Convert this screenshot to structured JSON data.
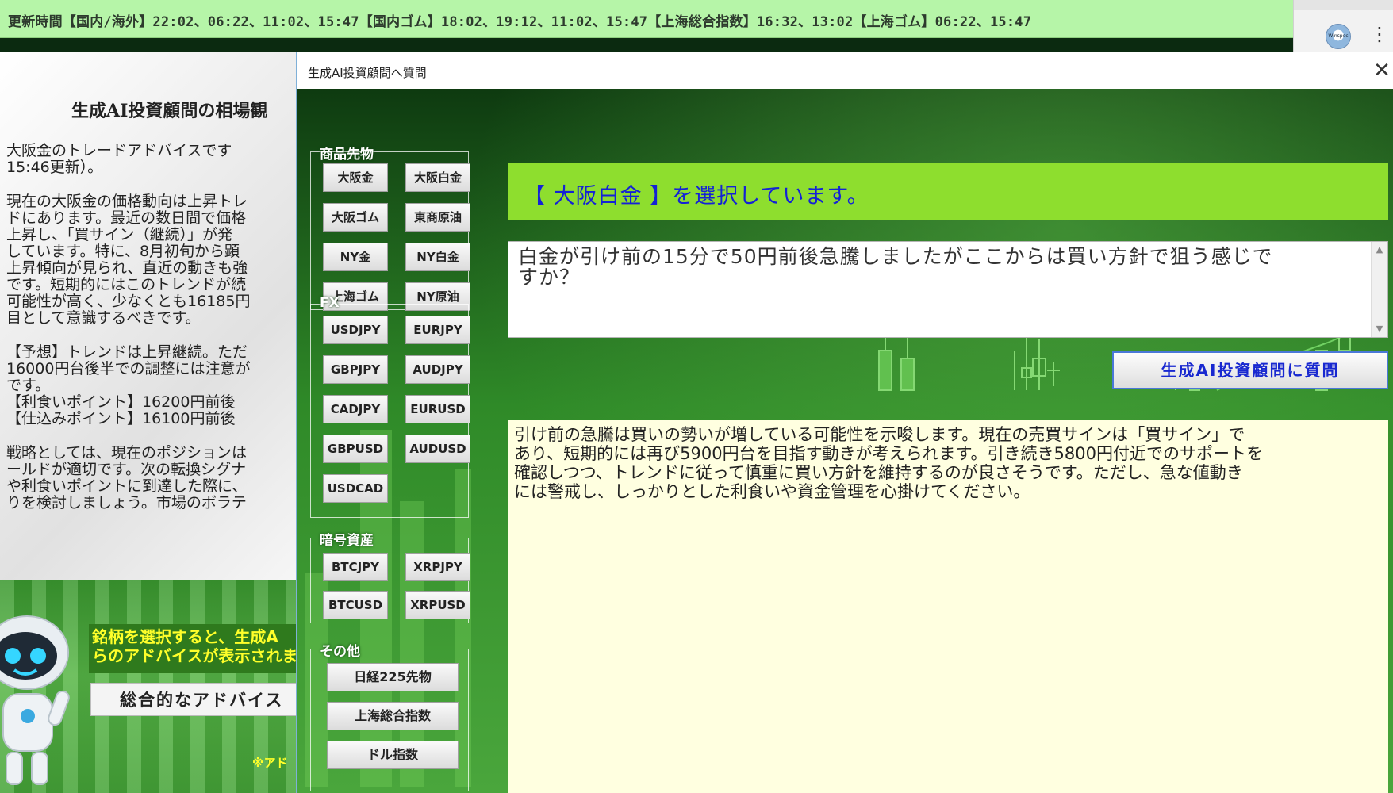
{
  "topbar": {
    "update_text": "更新時間【国内/海外】22:02、06:22、11:02、15:47【国内ゴム】18:02、19:12、11:02、15:47【上海総合指数】16:32、13:02【上海ゴム】06:22、15:47"
  },
  "browser": {
    "extension_label": "Winspec"
  },
  "left_panel": {
    "title": "生成AI投資顧問の相場観",
    "paragraphs": [
      "大阪金のトレードアドバイスです\n15:46更新）。",
      "現在の大阪金の価格動向は上昇トレ\nドにあります。最近の数日間で価格\n上昇し、「買サイン（継続）」が発\nしています。特に、8月初旬から顕\n上昇傾向が見られ、直近の動きも強\nです。短期的にはこのトレンドが続\n可能性が高く、少なくとも16185円\n目として意識するべきです。",
      "【予想】トレンドは上昇継続。ただ\n16000円台後半での調整には注意が\nです。\n【利食いポイント】16200円前後\n【仕込みポイント】16100円前後",
      "戦略としては、現在のポジションは\nールドが適切です。次の転換シグナ\nや利食いポイントに到達した際に、\nりを検討しましょう。市場のボラテ"
    ],
    "banner_text": "銘柄を選択すると、生成A\nらのアドバイスが表示されま",
    "advice_button": "総合的なアドバイス",
    "note": "※アド"
  },
  "dialog": {
    "title": "生成AI投資顧問へ質問",
    "groups": {
      "commodity": {
        "label": "商品先物",
        "buttons": [
          "大阪金",
          "大阪白金",
          "大阪ゴム",
          "東商原油",
          "NY金",
          "NY白金",
          "上海ゴム",
          "NY原油"
        ]
      },
      "fx": {
        "label": "FX",
        "buttons": [
          "USDJPY",
          "EURJPY",
          "GBPJPY",
          "AUDJPY",
          "CADJPY",
          "EURUSD",
          "GBPUSD",
          "AUDUSD",
          "USDCAD"
        ]
      },
      "crypto": {
        "label": "暗号資産",
        "buttons": [
          "BTCJPY",
          "XRPJPY",
          "BTCUSD",
          "XRPUSD"
        ]
      },
      "other": {
        "label": "その他",
        "buttons": [
          "日経225先物",
          "上海総合指数",
          "ドル指数"
        ]
      }
    },
    "selected_text": "【 大阪白金 】を選択しています。",
    "question_text": "白金が引け前の15分で50円前後急騰しましたがここからは買い方針で狙う感じで\nすか？",
    "ask_button": "生成AI投資顧問に質問",
    "answer_text": "引け前の急騰は買いの勢いが増している可能性を示唆します。現在の売買サインは「買サイン」で\nあり、短期的には再び5900円台を目指す動きが考えられます。引き続き5800円付近でのサポートを\n確認しつつ、トレンドに従って慎重に買い方針を維持するのが良さそうです。ただし、急な値動き\nには警戒し、しっかりとした利食いや資金管理を心掛けてください。"
  },
  "colors": {
    "topbar_bg": "#b6f5a8",
    "selected_bar": "#8ede2e",
    "selected_text": "#1422d6",
    "answer_bg": "#ffffe0",
    "banner_text": "#ffff2a"
  }
}
